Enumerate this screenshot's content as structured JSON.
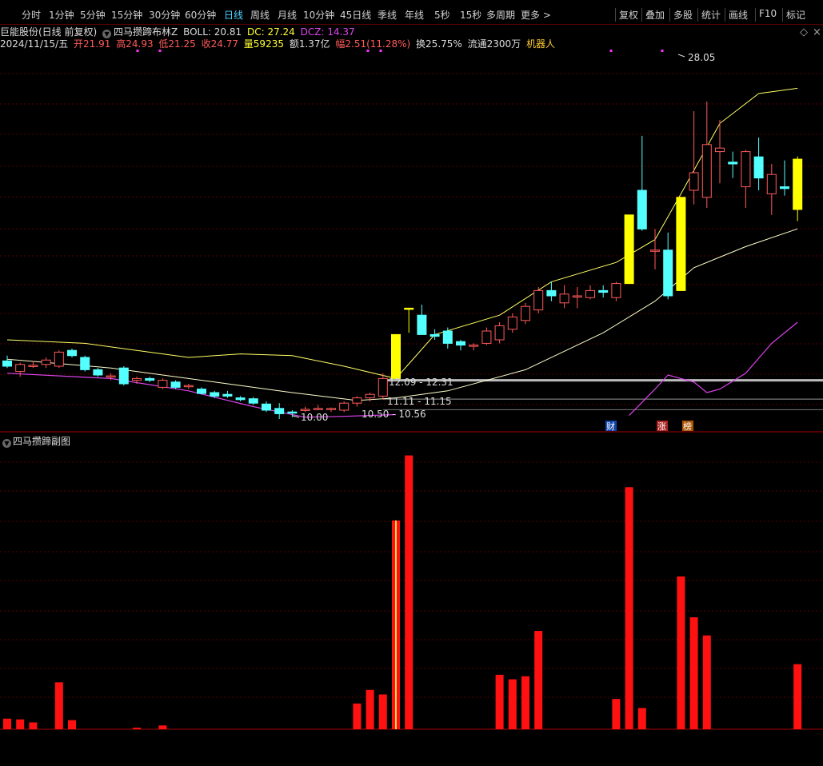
{
  "toolbar": {
    "buttons": [
      "分时",
      "1分钟",
      "5分钟",
      "15分钟",
      "30分钟",
      "60分钟",
      "日线",
      "周线",
      "月线",
      "10分钟",
      "45日线",
      "季线",
      "年线",
      "5秒",
      "15秒",
      "多周期",
      "更多 >"
    ],
    "active": "日线",
    "right_buttons": [
      "复权",
      "叠加",
      "多股",
      "统计",
      "画线",
      "F10",
      "标记"
    ]
  },
  "header": {
    "stock": "巨能股份(日线 前复权)",
    "indicator": "四马攒蹄布林Z",
    "boll_label": "BOLL: 20.81",
    "dc_label": "DC: 27.24",
    "dcz_label": "DCZ: 14.37"
  },
  "quote": {
    "date": "2024/11/15/五",
    "open": "开21.91",
    "high": "高24.93",
    "low": "低21.25",
    "close": "收24.77",
    "volume": "量59235",
    "amount": "额1.37亿",
    "change": "幅2.51(11.28%)",
    "turnover": "换25.75%",
    "float": "流通2300万",
    "tag": "机器人"
  },
  "chart_annotations": {
    "high_label": "28.05",
    "low_label": "10.00",
    "ranges": [
      "12.09 - 12.31",
      "11.11 - 11.15",
      "10.50 - 10.56"
    ],
    "badges": [
      "财",
      "涨",
      "榜"
    ]
  },
  "sub_panel": {
    "title": "四马攒蹄副图"
  },
  "colors": {
    "up": "#ff5a5a",
    "down": "#54ffff",
    "signal": "#ffff00",
    "boll": "#ffff66",
    "mid": "#ffffcc",
    "purple": "#dd44ee",
    "vol": "#ff1111"
  },
  "chart_data": {
    "type": "candlestick",
    "price_range": [
      9.5,
      31
    ],
    "candles": [
      {
        "o": 13.3,
        "h": 13.6,
        "l": 12.9,
        "c": 13.0
      },
      {
        "o": 12.7,
        "h": 13.2,
        "l": 12.4,
        "c": 13.1
      },
      {
        "o": 13.0,
        "h": 13.3,
        "l": 12.9,
        "c": 13.05
      },
      {
        "o": 13.1,
        "h": 13.5,
        "l": 12.9,
        "c": 13.35
      },
      {
        "o": 13.0,
        "h": 13.9,
        "l": 12.9,
        "c": 13.8
      },
      {
        "o": 13.9,
        "h": 14.0,
        "l": 13.5,
        "c": 13.6
      },
      {
        "o": 13.5,
        "h": 13.6,
        "l": 12.7,
        "c": 12.8
      },
      {
        "o": 12.8,
        "h": 12.9,
        "l": 12.4,
        "c": 12.5
      },
      {
        "o": 12.4,
        "h": 12.6,
        "l": 12.2,
        "c": 12.45
      },
      {
        "o": 12.9,
        "h": 13.0,
        "l": 11.9,
        "c": 12.0
      },
      {
        "o": 12.2,
        "h": 12.4,
        "l": 12.0,
        "c": 12.3
      },
      {
        "o": 12.3,
        "h": 12.4,
        "l": 12.1,
        "c": 12.2
      },
      {
        "o": 11.8,
        "h": 12.3,
        "l": 11.7,
        "c": 12.2
      },
      {
        "o": 12.1,
        "h": 12.2,
        "l": 11.7,
        "c": 11.8
      },
      {
        "o": 11.85,
        "h": 12.0,
        "l": 11.7,
        "c": 11.9
      },
      {
        "o": 11.7,
        "h": 11.8,
        "l": 11.4,
        "c": 11.45
      },
      {
        "o": 11.5,
        "h": 11.6,
        "l": 11.2,
        "c": 11.3
      },
      {
        "o": 11.4,
        "h": 11.6,
        "l": 11.2,
        "c": 11.3
      },
      {
        "o": 11.2,
        "h": 11.3,
        "l": 11.0,
        "c": 11.1
      },
      {
        "o": 11.15,
        "h": 11.25,
        "l": 10.8,
        "c": 10.9
      },
      {
        "o": 10.85,
        "h": 11.0,
        "l": 10.4,
        "c": 10.5
      },
      {
        "o": 10.6,
        "h": 10.9,
        "l": 10.0,
        "c": 10.3
      },
      {
        "o": 10.4,
        "h": 10.5,
        "l": 10.1,
        "c": 10.35
      },
      {
        "o": 10.5,
        "h": 10.7,
        "l": 10.4,
        "c": 10.55
      },
      {
        "o": 10.6,
        "h": 10.8,
        "l": 10.5,
        "c": 10.6
      },
      {
        "o": 10.55,
        "h": 10.65,
        "l": 10.4,
        "c": 10.6
      },
      {
        "o": 10.5,
        "h": 11.0,
        "l": 10.4,
        "c": 10.9
      },
      {
        "o": 10.9,
        "h": 11.3,
        "l": 10.7,
        "c": 11.2
      },
      {
        "o": 11.2,
        "h": 11.5,
        "l": 11.0,
        "c": 11.4
      },
      {
        "o": 11.3,
        "h": 12.6,
        "l": 11.1,
        "c": 12.3
      },
      {
        "o": 12.3,
        "h": 14.8,
        "l": 12.3,
        "c": 14.8,
        "s": 1
      },
      {
        "o": 16.3,
        "h": 16.3,
        "l": 14.9,
        "c": 16.3,
        "s": 1
      },
      {
        "o": 15.9,
        "h": 16.5,
        "l": 14.8,
        "c": 14.8
      },
      {
        "o": 14.8,
        "h": 15.1,
        "l": 14.5,
        "c": 14.7
      },
      {
        "o": 15.0,
        "h": 15.2,
        "l": 14.0,
        "c": 14.3
      },
      {
        "o": 14.4,
        "h": 14.5,
        "l": 13.9,
        "c": 14.2
      },
      {
        "o": 14.2,
        "h": 14.3,
        "l": 13.9,
        "c": 14.2
      },
      {
        "o": 14.3,
        "h": 15.2,
        "l": 14.2,
        "c": 15.0
      },
      {
        "o": 14.5,
        "h": 15.5,
        "l": 14.3,
        "c": 15.3
      },
      {
        "o": 15.1,
        "h": 16.0,
        "l": 14.9,
        "c": 15.8
      },
      {
        "o": 15.6,
        "h": 16.6,
        "l": 15.4,
        "c": 16.4
      },
      {
        "o": 16.2,
        "h": 17.5,
        "l": 16.0,
        "c": 17.3
      },
      {
        "o": 17.3,
        "h": 17.8,
        "l": 16.7,
        "c": 17.0
      },
      {
        "o": 16.6,
        "h": 17.6,
        "l": 16.3,
        "c": 17.1
      },
      {
        "o": 17.0,
        "h": 17.5,
        "l": 16.3,
        "c": 17.0
      },
      {
        "o": 16.9,
        "h": 17.6,
        "l": 16.8,
        "c": 17.3
      },
      {
        "o": 17.3,
        "h": 17.6,
        "l": 16.9,
        "c": 17.2
      },
      {
        "o": 16.9,
        "h": 17.8,
        "l": 16.7,
        "c": 17.7
      },
      {
        "o": 17.7,
        "h": 21.6,
        "l": 17.7,
        "c": 21.6,
        "s": 1
      },
      {
        "o": 23.0,
        "h": 26.1,
        "l": 20.7,
        "c": 20.8
      },
      {
        "o": 19.6,
        "h": 20.8,
        "l": 18.5,
        "c": 19.6
      },
      {
        "o": 19.6,
        "h": 20.6,
        "l": 16.8,
        "c": 17.0
      },
      {
        "o": 17.3,
        "h": 22.6,
        "l": 17.3,
        "c": 22.6,
        "s": 1
      },
      {
        "o": 23.0,
        "h": 27.5,
        "l": 22.2,
        "c": 24.0
      },
      {
        "o": 22.6,
        "h": 28.05,
        "l": 22.0,
        "c": 25.6
      },
      {
        "o": 25.2,
        "h": 27.0,
        "l": 23.4,
        "c": 25.4
      },
      {
        "o": 24.6,
        "h": 25.2,
        "l": 23.7,
        "c": 24.5
      },
      {
        "o": 23.2,
        "h": 25.3,
        "l": 22.0,
        "c": 25.2
      },
      {
        "o": 24.9,
        "h": 26.0,
        "l": 23.0,
        "c": 23.7
      },
      {
        "o": 22.8,
        "h": 24.5,
        "l": 21.6,
        "c": 23.9
      },
      {
        "o": 23.2,
        "h": 24.7,
        "l": 22.7,
        "c": 23.1
      },
      {
        "o": 21.91,
        "h": 24.93,
        "l": 21.25,
        "c": 24.77,
        "s": 1
      }
    ],
    "indicator_bars": [
      0.7,
      0.65,
      0.45,
      0,
      3.1,
      0.6,
      0,
      0,
      0,
      0,
      0.1,
      0,
      0.25,
      0,
      0,
      0,
      0,
      0,
      0,
      0,
      0,
      0,
      0,
      0,
      0,
      0,
      0,
      1.7,
      2.6,
      2.3,
      13.8,
      18.1,
      0,
      0,
      0,
      0,
      0,
      0,
      3.6,
      3.3,
      3.5,
      6.5,
      0,
      0,
      0,
      0,
      0,
      2.0,
      16.0,
      1.4,
      0,
      0,
      10.1,
      7.4,
      6.2,
      0,
      0,
      0,
      0,
      0,
      0,
      4.3
    ],
    "indicator_range": [
      0,
      18.5
    ],
    "upper_band": [
      [
        0,
        14.5
      ],
      [
        6,
        14.3
      ],
      [
        10,
        13.9
      ],
      [
        14,
        13.5
      ],
      [
        18,
        13.7
      ],
      [
        22,
        13.6
      ],
      [
        26,
        13.0
      ],
      [
        30,
        12.3
      ],
      [
        33,
        14.8
      ],
      [
        38,
        15.9
      ],
      [
        42,
        17.8
      ],
      [
        47,
        18.9
      ],
      [
        50,
        20.2
      ],
      [
        52,
        22.8
      ],
      [
        55,
        26.8
      ],
      [
        58,
        28.5
      ],
      [
        61,
        28.8
      ]
    ],
    "middle_band": [
      [
        0,
        13.4
      ],
      [
        8,
        12.9
      ],
      [
        16,
        12.1
      ],
      [
        22,
        11.5
      ],
      [
        27,
        11.05
      ],
      [
        30,
        11.2
      ],
      [
        34,
        11.6
      ],
      [
        40,
        12.8
      ],
      [
        46,
        14.9
      ],
      [
        50,
        16.7
      ],
      [
        53,
        18.6
      ],
      [
        57,
        19.8
      ],
      [
        61,
        20.81
      ]
    ],
    "lower_band": [
      [
        0,
        12.6
      ],
      [
        8,
        12.3
      ],
      [
        14,
        11.6
      ],
      [
        19,
        10.7
      ],
      [
        23,
        10.1
      ],
      [
        26,
        10.15
      ],
      [
        30,
        10.25
      ]
    ],
    "purple_line": [
      [
        48,
        10.2
      ],
      [
        50,
        11.7
      ],
      [
        51,
        12.5
      ],
      [
        53,
        12.1
      ],
      [
        54,
        11.5
      ],
      [
        55,
        11.7
      ],
      [
        57,
        12.6
      ],
      [
        59,
        14.3
      ],
      [
        61,
        15.5
      ]
    ]
  }
}
